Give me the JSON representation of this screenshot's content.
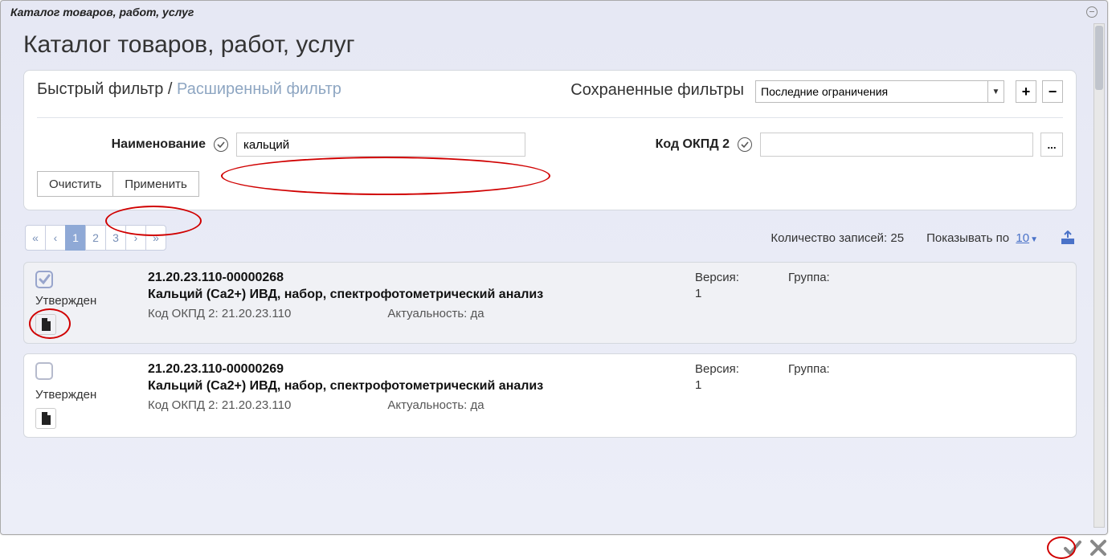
{
  "window": {
    "title": "Каталог товаров, работ, услуг"
  },
  "page": {
    "heading": "Каталог товаров, работ, услуг"
  },
  "filter_tabs": {
    "quick": "Быстрый фильтр",
    "sep": "/",
    "advanced": "Расширенный фильтр"
  },
  "saved_filters": {
    "label": "Сохраненные фильтры",
    "selected": "Последние ограничения"
  },
  "fields": {
    "name_label": "Наименование",
    "name_value": "кальций",
    "okpd_label": "Код ОКПД 2",
    "okpd_value": ""
  },
  "buttons": {
    "clear": "Очистить",
    "apply": "Применить",
    "ellipsis": "...",
    "plus": "+",
    "minus": "−"
  },
  "pager": {
    "first": "«",
    "prev": "‹",
    "p1": "1",
    "p2": "2",
    "p3": "3",
    "next": "›",
    "last": "»"
  },
  "pager_info": {
    "count_label": "Количество записей: 25",
    "show_label": "Показывать по",
    "show_value": "10"
  },
  "item_labels": {
    "version": "Версия:",
    "group": "Группа:",
    "okpd_prefix": "Код ОКПД 2:",
    "actual_prefix": "Актуальность:"
  },
  "items": [
    {
      "selected": true,
      "status": "Утвержден",
      "code": "21.20.23.110-00000268",
      "name": "Кальций (Ca2+) ИВД, набор, спектрофотометрический анализ",
      "okpd": "21.20.23.110",
      "actual": "да",
      "version": "1",
      "group": ""
    },
    {
      "selected": false,
      "status": "Утвержден",
      "code": "21.20.23.110-00000269",
      "name": "Кальций (Ca2+) ИВД, набор, спектрофотометрический анализ",
      "okpd": "21.20.23.110",
      "actual": "да",
      "version": "1",
      "group": ""
    }
  ]
}
